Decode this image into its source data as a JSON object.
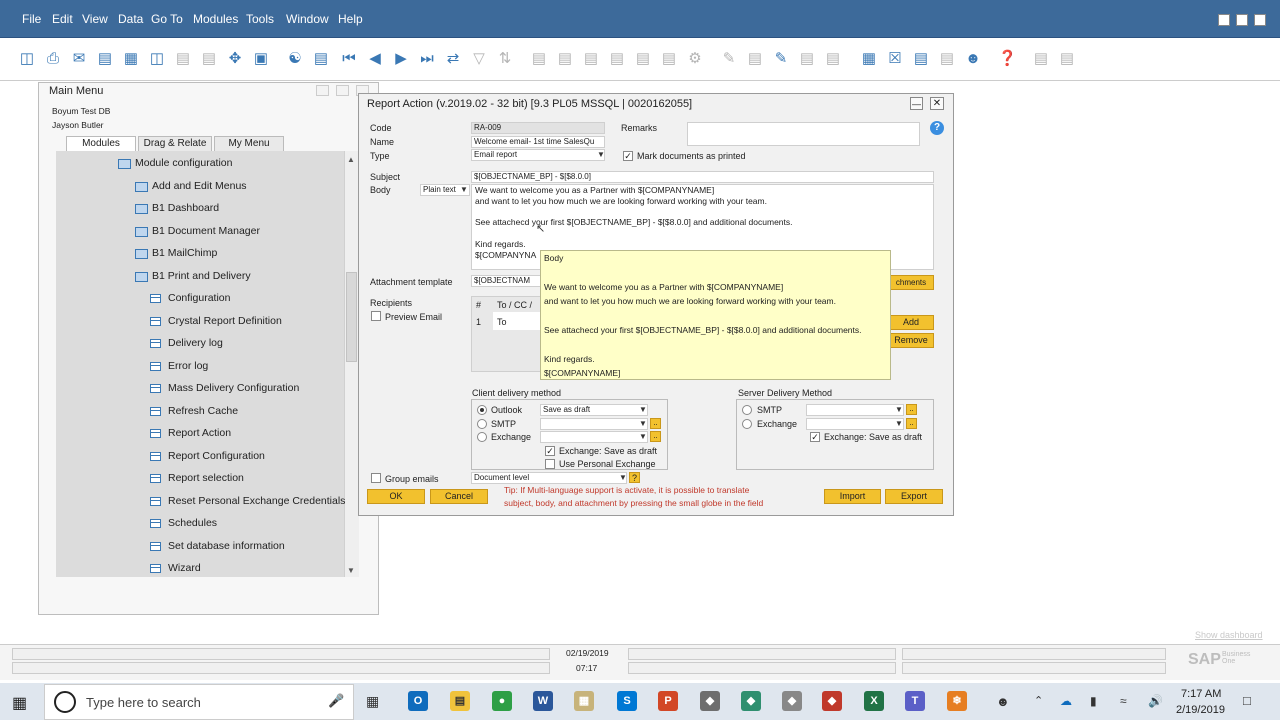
{
  "menubar": {
    "items": [
      "File",
      "Edit",
      "View",
      "Data",
      "Go To",
      "Modules",
      "Tools",
      "Window",
      "Help"
    ]
  },
  "main_menu": {
    "title": "Main Menu",
    "db": "Boyum Test DB",
    "user": "Jayson Butler",
    "tabs": [
      "Modules",
      "Drag & Relate",
      "My Menu"
    ],
    "items": [
      {
        "label": "Module configuration",
        "type": "folder-open"
      },
      {
        "label": "Add and Edit Menus",
        "type": "folder"
      },
      {
        "label": "B1 Dashboard",
        "type": "folder"
      },
      {
        "label": "B1 Document Manager",
        "type": "folder"
      },
      {
        "label": "B1 MailChimp",
        "type": "folder"
      },
      {
        "label": "B1 Print and Delivery",
        "type": "folder-open"
      },
      {
        "label": "Configuration",
        "type": "form"
      },
      {
        "label": "Crystal Report Definition",
        "type": "form"
      },
      {
        "label": "Delivery log",
        "type": "form"
      },
      {
        "label": "Error log",
        "type": "form"
      },
      {
        "label": "Mass Delivery Configuration",
        "type": "form"
      },
      {
        "label": "Refresh Cache",
        "type": "form"
      },
      {
        "label": "Report Action",
        "type": "form"
      },
      {
        "label": "Report Configuration",
        "type": "form"
      },
      {
        "label": "Report selection",
        "type": "form"
      },
      {
        "label": "Reset Personal Exchange Credentials",
        "type": "form"
      },
      {
        "label": "Schedules",
        "type": "form"
      },
      {
        "label": "Set database information",
        "type": "form"
      },
      {
        "label": "Wizard",
        "type": "form"
      }
    ]
  },
  "dialog": {
    "title": "Report Action (v.2019.02 - 32 bit) [9.3 PL05 MSSQL | 0020162055]",
    "code_label": "Code",
    "code": "RA-009",
    "name_label": "Name",
    "name": "Welcome email- 1st time SalesQu",
    "type_label": "Type",
    "type": "Email report",
    "remarks_label": "Remarks",
    "mark_printed": "Mark documents as printed",
    "subject_label": "Subject",
    "subject": "$[OBJECTNAME_BP] - $[$8.0.0]",
    "body_label": "Body",
    "body_format": "Plain text",
    "body_lines": [
      "We want to welcome you as a Partner with $[COMPANYNAME]",
      "and want to let you how much we are looking forward working with your team.",
      "",
      "See attachecd your first  $[OBJECTNAME_BP] - $[$8.0.0] and additional documents.",
      "",
      "Kind regards.",
      "$[COMPANYNA"
    ],
    "attachment_label": "Attachment template",
    "attachment": "$[OBJECTNAM",
    "attachments_btn": "chments",
    "recipients_label": "Recipients",
    "preview_email": "Preview Email",
    "grid_hash": "#",
    "grid_col": "To / CC /",
    "grid_row_num": "1",
    "grid_row_val": "To",
    "add_btn": "Add",
    "remove_btn": "Remove",
    "client_delivery_label": "Client delivery method",
    "client_opts": [
      "Outlook",
      "SMTP",
      "Exchange"
    ],
    "client_outlook_value": "Save as draft",
    "exchange_save_draft": "Exchange: Save as draft",
    "use_personal_exchange": "Use Personal Exchange",
    "server_delivery_label": "Server Delivery Method",
    "server_opts": [
      "SMTP",
      "Exchange"
    ],
    "server_exchange_save": "Exchange: Save as draft",
    "group_emails": "Group emails",
    "doc_level": "Document level",
    "tip": "Tip: If Multi-language support is activate, it is possible to translate",
    "tip2": "subject, body, and attachment by pressing the small globe in the field",
    "ok": "OK",
    "cancel": "Cancel",
    "import": "Import",
    "export": "Export"
  },
  "tooltip": {
    "title": "Body",
    "lines": [
      "We want to welcome you as a Partner with $[COMPANYNAME]",
      "and want to let you how much we are looking forward working with your team.",
      "",
      "See attachecd your first  $[OBJECTNAME_BP] - $[$8.0.0] and additional documents.",
      "",
      "Kind regards.",
      "$[COMPANYNAME]"
    ]
  },
  "status": {
    "date": "02/19/2019",
    "time": "07:17",
    "show_dashboard": "Show dashboard",
    "brand": "SAP",
    "brand_sub": "Business One"
  },
  "taskbar": {
    "search_placeholder": "Type here to search",
    "clock_time": "7:17 AM",
    "clock_date": "2/19/2019"
  }
}
